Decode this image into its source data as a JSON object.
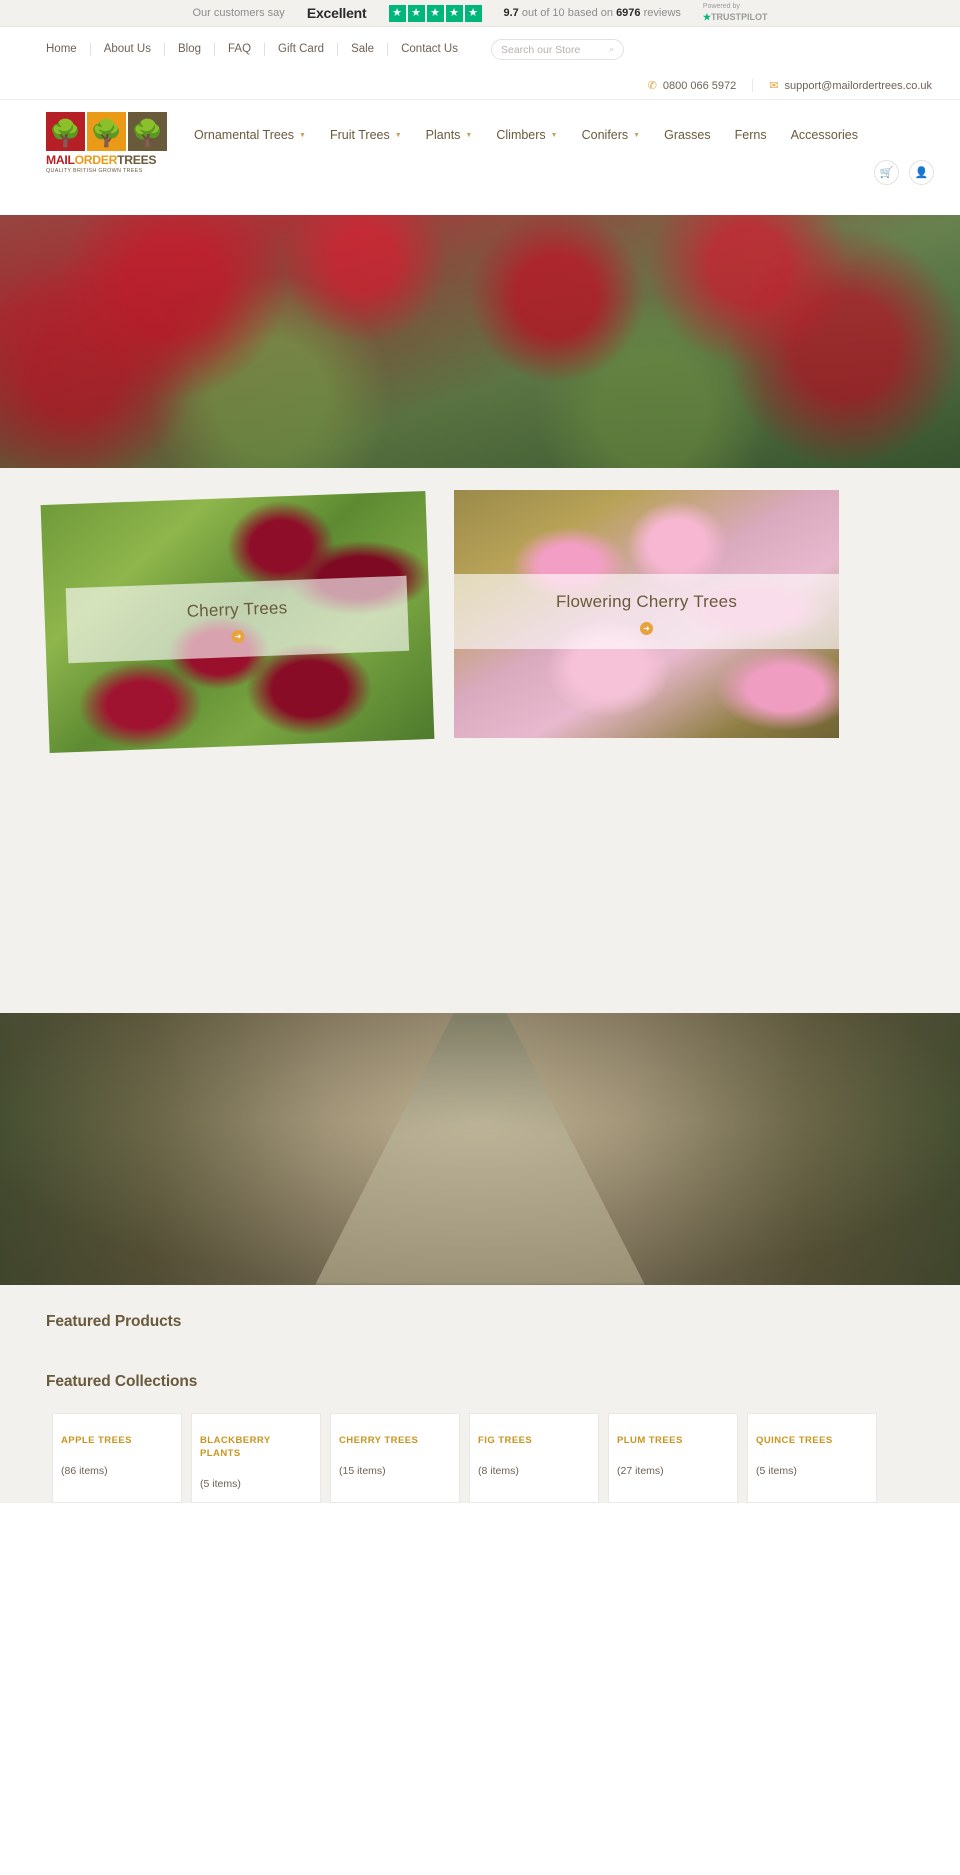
{
  "trustpilot": {
    "lead": "Our customers say",
    "rating_word": "Excellent",
    "stars": 5,
    "score": "9.7",
    "score_mid": "out of 10 based on",
    "reviews_count": "6976",
    "reviews_word": "reviews",
    "powered_by": "Powered by",
    "brand_first": "TRUST",
    "brand_second": "PILOT",
    "star_color": "#00b67a"
  },
  "utility_nav": {
    "links": [
      {
        "label": "Home"
      },
      {
        "label": "About Us"
      },
      {
        "label": "Blog"
      },
      {
        "label": "FAQ"
      },
      {
        "label": "Gift Card"
      },
      {
        "label": "Sale"
      },
      {
        "label": "Contact Us"
      }
    ],
    "search_placeholder": "Search our Store"
  },
  "contact": {
    "phone": "0800 066 5972",
    "email": "support@mailordertrees.co.uk"
  },
  "logo": {
    "word_part1": "MAIL",
    "word_part2": "ORDER",
    "word_part3": "TREES",
    "tagline": "QUALITY BRITISH GROWN TREES",
    "square_colors": [
      "#b51f25",
      "#eb9a18",
      "#6a5a3c"
    ]
  },
  "main_nav": {
    "items": [
      {
        "label": "Ornamental Trees",
        "has_dropdown": true
      },
      {
        "label": "Fruit Trees",
        "has_dropdown": true
      },
      {
        "label": "Plants",
        "has_dropdown": true
      },
      {
        "label": "Climbers",
        "has_dropdown": true
      },
      {
        "label": "Conifers",
        "has_dropdown": true
      },
      {
        "label": "Grasses",
        "has_dropdown": false
      },
      {
        "label": "Ferns",
        "has_dropdown": false
      },
      {
        "label": "Accessories",
        "has_dropdown": false
      }
    ]
  },
  "header_icons": {
    "cart": "cart-icon",
    "account": "account-icon"
  },
  "promo_tiles": [
    {
      "title": "Cherry Trees"
    },
    {
      "title": "Flowering Cherry Trees"
    }
  ],
  "sections": {
    "featured_products_title": "Featured Products",
    "featured_collections_title": "Featured Collections"
  },
  "collections": [
    {
      "name": "APPLE TREES",
      "count": "(86 items)"
    },
    {
      "name": "BLACKBERRY PLANTS",
      "count": "(5 items)"
    },
    {
      "name": "CHERRY TREES",
      "count": "(15 items)"
    },
    {
      "name": "FIG TREES",
      "count": "(8 items)"
    },
    {
      "name": "PLUM TREES",
      "count": "(27 items)"
    },
    {
      "name": "QUINCE TREES",
      "count": "(5 items)"
    }
  ]
}
